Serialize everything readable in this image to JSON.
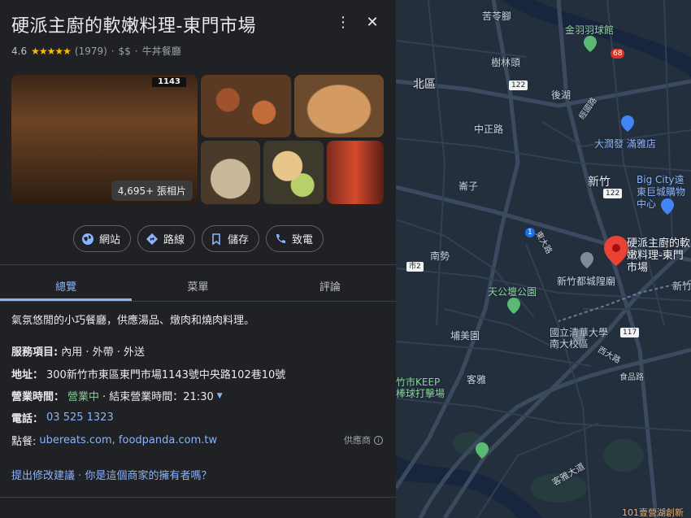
{
  "place": {
    "title": "硬派主廚的軟嫩料理-東門市場",
    "rating": "4.6",
    "stars": "★★★★★",
    "review_count": "(1979)",
    "dot1": "·",
    "price": "$$",
    "dot2": "·",
    "category": "牛丼餐廳",
    "photo_count": "4,695+ 張相片",
    "sign_text": "1143"
  },
  "actions": {
    "website": "網站",
    "directions": "路線",
    "save": "儲存",
    "call": "致電"
  },
  "icons": {
    "website": "globe-icon",
    "directions": "directions-icon",
    "save": "bookmark-icon",
    "call": "phone-icon",
    "more": "more-vert-icon",
    "close": "close-icon"
  },
  "tabs": [
    "總覽",
    "菜單",
    "評論"
  ],
  "description": "氣氛悠閒的小巧餐廳，供應湯品、燉肉和燒肉料理。",
  "info": {
    "service_label": "服務項目:",
    "service_value": "內用 · 外帶 · 外送",
    "address_label": "地址：",
    "address_value": "300新竹市東區東門市場1143號中央路102巷10號",
    "hours_label": "營業時間：",
    "hours_open": "營業中",
    "hours_rest": "· 結束營業時間：21:30",
    "phone_label": "電話：",
    "phone_value": "03 525 1323",
    "order_label": "點餐:",
    "order_value": "ubereats.com, foodpanda.com.tw",
    "provider": "供應商",
    "provider_icon": "i"
  },
  "suggest": {
    "edit": "提出修改建議",
    "sep": "·",
    "owner": "你是這個商家的擁有者嗎？"
  },
  "colors": {
    "panel_bg": "#202124",
    "map_bg": "#242f3e",
    "accent": "#8ab4f8",
    "open_green": "#81c995",
    "star": "#fbbc04",
    "pin": "#ea4335"
  },
  "map": {
    "labels": {
      "l1": "苦苓腳",
      "l2": "金羽羽球館",
      "l3": "樹林頭",
      "l4": "北區",
      "l5": "後湖",
      "l6": "中正路",
      "l7": "大潤發 滿雅店",
      "l8": "新竹",
      "l9": "Big City遠東巨城購物中心",
      "l10": "崙子",
      "l11": "南勢",
      "l12": "新竹都城隍廟",
      "l13": "天公壇公園",
      "l14": "埔美園",
      "l15": "國立清華大學南大校區",
      "l16": "客雅",
      "l17": "竹市KEEP 棒球打擊場",
      "l18": "食品路",
      "l19": "客雅大道",
      "l20": "101壹營湖創新",
      "l21": "新竹",
      "l22": "經國路",
      "l23": "西大路",
      "l24": "東大路",
      "pin_label": "硬派主廚的軟嫩料理-東門市場",
      "r122a": "122",
      "r122b": "122",
      "r68": "68",
      "r1": "1",
      "r117": "117",
      "r2": "市2"
    }
  }
}
